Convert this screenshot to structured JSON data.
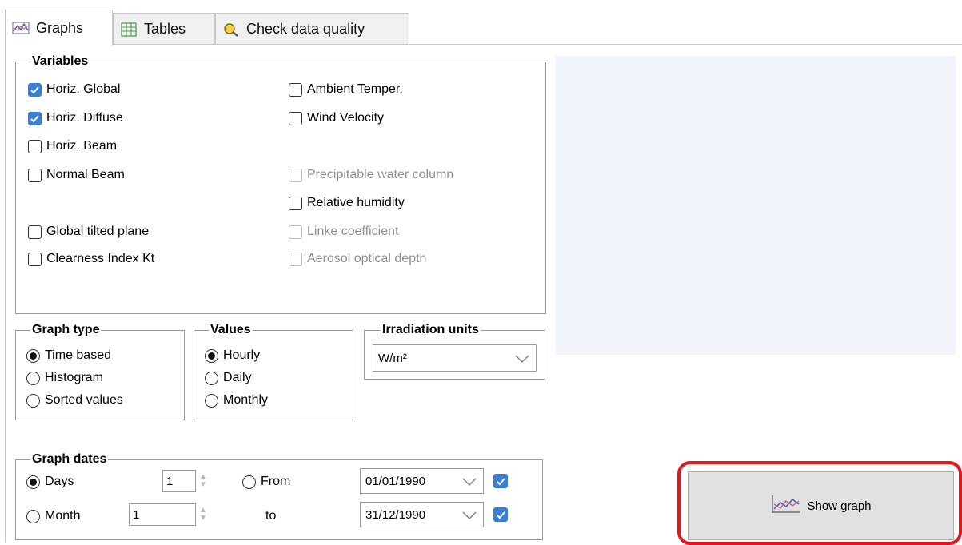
{
  "tabs": [
    {
      "label": "Graphs",
      "icon": "graph-icon",
      "active": true
    },
    {
      "label": "Tables",
      "icon": "table-icon",
      "active": false
    },
    {
      "label": "Check data quality",
      "icon": "magnifier-icon",
      "active": false
    }
  ],
  "variables": {
    "title": "Variables",
    "left": [
      {
        "label": "Horiz. Global",
        "checked": true,
        "enabled": true
      },
      {
        "label": "Horiz. Diffuse",
        "checked": true,
        "enabled": true
      },
      {
        "label": "Horiz. Beam",
        "checked": false,
        "enabled": true
      },
      {
        "label": "Normal Beam",
        "checked": false,
        "enabled": true
      },
      {
        "label": "Global tilted plane",
        "checked": false,
        "enabled": true
      },
      {
        "label": "Clearness Index Kt",
        "checked": false,
        "enabled": true
      }
    ],
    "right": [
      {
        "label": "Ambient Temper.",
        "checked": false,
        "enabled": true
      },
      {
        "label": "Wind Velocity",
        "checked": false,
        "enabled": true
      },
      {
        "label": "Precipitable water column",
        "checked": false,
        "enabled": false
      },
      {
        "label": "Relative humidity",
        "checked": false,
        "enabled": true
      },
      {
        "label": "Linke coefficient",
        "checked": false,
        "enabled": false
      },
      {
        "label": "Aerosol optical depth",
        "checked": false,
        "enabled": false
      }
    ]
  },
  "graph_type": {
    "title": "Graph type",
    "options": [
      "Time based",
      "Histogram",
      "Sorted values"
    ],
    "selected": "Time based"
  },
  "values": {
    "title": "Values",
    "options": [
      "Hourly",
      "Daily",
      "Monthly"
    ],
    "selected": "Hourly"
  },
  "irradiation_units": {
    "title": "Irradiation units",
    "selected": "W/m²"
  },
  "graph_dates": {
    "title": "Graph dates",
    "days_label": "Days",
    "days_value": "1",
    "month_label": "Month",
    "month_value": "1",
    "from_label": "From",
    "to_label": "to",
    "from_date": "01/01/1990",
    "to_date": "31/12/1990",
    "from_checked": true,
    "to_checked": true,
    "selected": "Days"
  },
  "show_graph": {
    "label": "Show graph",
    "icon": "chart-icon"
  },
  "colors": {
    "accent": "#3a7fd5",
    "highlight": "#e0171b",
    "preview_bg": "#f1f4fb"
  }
}
